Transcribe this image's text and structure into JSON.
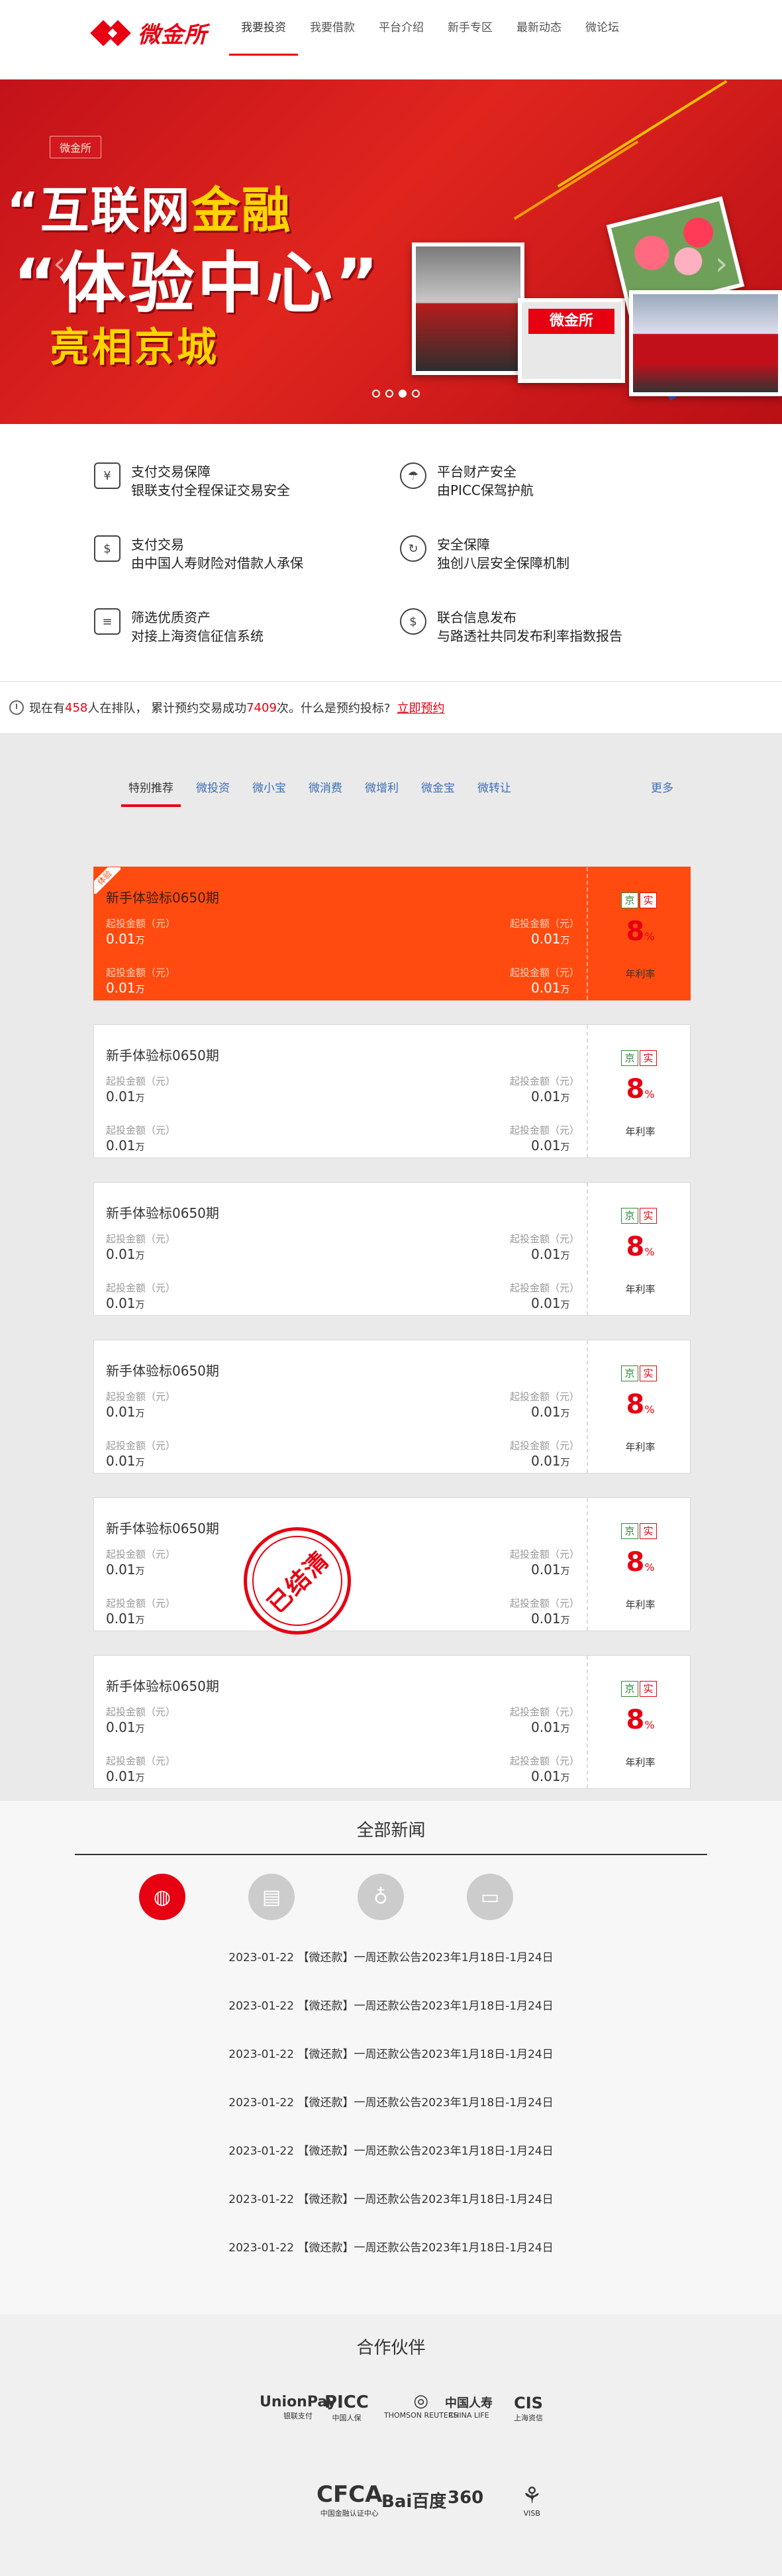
{
  "brand": {
    "name": "微金所",
    "red": "#e60012",
    "orange": "#ff4b0f"
  },
  "nav": [
    {
      "label": "我要投资",
      "active": true
    },
    {
      "label": "我要借款"
    },
    {
      "label": "平台介绍"
    },
    {
      "label": "新手专区"
    },
    {
      "label": "最新动态"
    },
    {
      "label": "微论坛"
    }
  ],
  "banner": {
    "tag": "微金所",
    "line1_white": "“互联网",
    "line1_gold": "金融",
    "line2": "“体验中心”",
    "line3": "亮相京城",
    "photo_logo": "微金所",
    "dots": [
      false,
      false,
      true,
      false
    ],
    "prev_icon": "chevron-left-icon",
    "next_icon": "chevron-right-icon"
  },
  "features": [
    {
      "icon": "payment-security-icon",
      "line1": "支付交易保障",
      "line2": "银联支付全程保证交易安全"
    },
    {
      "icon": "umbrella-icon",
      "line1": "平台财产安全",
      "line2": "由PICC保驾护航"
    },
    {
      "icon": "dollar-shield-icon",
      "line1": "支付交易",
      "line2": "由中国人寿财险对借款人承保"
    },
    {
      "icon": "refresh-icon",
      "line1": "安全保障",
      "line2": "独创八层安全保障机制"
    },
    {
      "icon": "news-doc-icon",
      "line1": "筛选优质资产",
      "line2": "对接上海资信征信系统"
    },
    {
      "icon": "info-dollar-icon",
      "line1": "联合信息发布",
      "line2": "与路透社共同发布利率指数报告"
    }
  ],
  "queue": {
    "pre": "现在有",
    "count": "458",
    "mid": "人在排队，  累计预约交易成功",
    "success": "7409",
    "post": "次。什么是预约投标?",
    "link": "立即预约"
  },
  "tabs": [
    "特别推荐",
    "微投资",
    "微小宝",
    "微消费",
    "微增利",
    "微金宝",
    "微转让"
  ],
  "tabs_more": "更多",
  "products": [
    {
      "title": "新手体验标0650期",
      "badge": "体验",
      "hot": true,
      "settled": false,
      "min_label": "起投金额（元）",
      "min_value": "0.01",
      "unit": "万",
      "tag_a": "京",
      "tag_b": "实",
      "rate": "8",
      "rate_unit": "%",
      "rate_label": "年利率"
    },
    {
      "title": "新手体验标0650期",
      "hot": false,
      "settled": false,
      "min_label": "起投金额（元）",
      "min_value": "0.01",
      "unit": "万",
      "tag_a": "京",
      "tag_b": "实",
      "rate": "8",
      "rate_unit": "%",
      "rate_label": "年利率"
    },
    {
      "title": "新手体验标0650期",
      "hot": false,
      "settled": false,
      "min_label": "起投金额（元）",
      "min_value": "0.01",
      "unit": "万",
      "tag_a": "京",
      "tag_b": "实",
      "rate": "8",
      "rate_unit": "%",
      "rate_label": "年利率"
    },
    {
      "title": "新手体验标0650期",
      "hot": false,
      "settled": false,
      "min_label": "起投金额（元）",
      "min_value": "0.01",
      "unit": "万",
      "tag_a": "京",
      "tag_b": "实",
      "rate": "8",
      "rate_unit": "%",
      "rate_label": "年利率"
    },
    {
      "title": "新手体验标0650期",
      "hot": false,
      "settled": true,
      "stamp": "已结清",
      "min_label": "起投金额（元）",
      "min_value": "0.01",
      "unit": "万",
      "tag_a": "京",
      "tag_b": "实",
      "rate": "8",
      "rate_unit": "%",
      "rate_label": "年利率"
    },
    {
      "title": "新手体验标0650期",
      "hot": false,
      "settled": false,
      "min_label": "起投金额（元）",
      "min_value": "0.01",
      "unit": "万",
      "tag_a": "京",
      "tag_b": "实",
      "rate": "8",
      "rate_unit": "%",
      "rate_label": "年利率"
    }
  ],
  "news": {
    "title": "全部新闻",
    "categories": [
      {
        "icon": "globe-icon",
        "active": true
      },
      {
        "icon": "newspaper-icon"
      },
      {
        "icon": "microphone-icon"
      },
      {
        "icon": "monitor-icon"
      }
    ],
    "items": [
      {
        "date": "2023-01-22",
        "text": "【微还款】一周还款公告2023年1月18日-1月24日"
      },
      {
        "date": "2023-01-22",
        "text": "【微还款】一周还款公告2023年1月18日-1月24日"
      },
      {
        "date": "2023-01-22",
        "text": "【微还款】一周还款公告2023年1月18日-1月24日"
      },
      {
        "date": "2023-01-22",
        "text": "【微还款】一周还款公告2023年1月18日-1月24日"
      },
      {
        "date": "2023-01-22",
        "text": "【微还款】一周还款公告2023年1月18日-1月24日"
      },
      {
        "date": "2023-01-22",
        "text": "【微还款】一周还款公告2023年1月18日-1月24日"
      },
      {
        "date": "2023-01-22",
        "text": "【微还款】一周还款公告2023年1月18日-1月24日"
      }
    ]
  },
  "partners": {
    "title": "合作伙伴",
    "logos": [
      {
        "main": "UnionPay",
        "sub": "银联支付"
      },
      {
        "main": "PICC",
        "sub": "中国人保"
      },
      {
        "main": "◎",
        "sub": "THOMSON REUTERS"
      },
      {
        "main": "中国人寿",
        "sub": "CHINA LIFE"
      },
      {
        "main": "CIS",
        "sub": "上海资信"
      },
      {
        "main": "CFCA",
        "sub": "中国金融认证中心"
      },
      {
        "main": "Bai百度",
        "sub": ""
      },
      {
        "main": "360",
        "sub": ""
      },
      {
        "main": "⚘",
        "sub": "VISB"
      }
    ]
  }
}
